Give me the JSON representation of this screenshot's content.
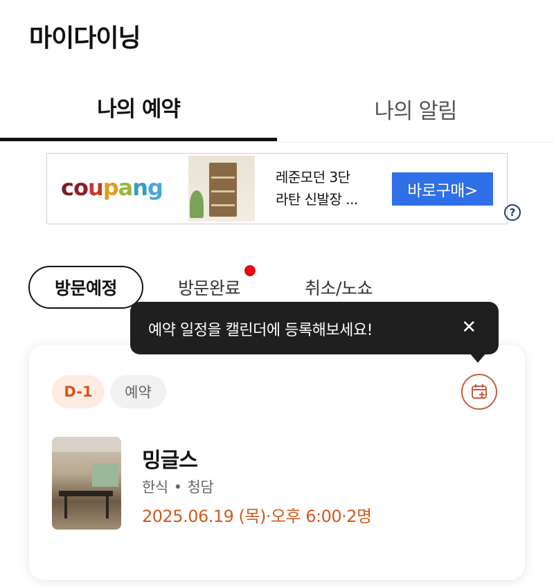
{
  "header": {
    "title": "마이다이닝"
  },
  "tabs": [
    {
      "label": "나의 예약",
      "active": true
    },
    {
      "label": "나의 알림",
      "active": false
    }
  ],
  "ad": {
    "logo": "coupang",
    "product_line1": "레준모던 3단",
    "product_line2": "라탄 신발장 ...",
    "cta": "바로구매>",
    "help_icon": "question-circle-icon",
    "cta_color": "#2f6fe8"
  },
  "filters": {
    "items": [
      "방문예정",
      "방문완료",
      "취소/노쇼"
    ],
    "selected": "방문예정",
    "notification_dot_on": "방문완료"
  },
  "tooltip": {
    "text": "예약 일정을 캘린더에 등록해보세요!",
    "close_icon": "close-icon"
  },
  "reservation": {
    "dday": "D-1",
    "status": "예약",
    "calendar_icon": "calendar-add-icon",
    "restaurant": "밍글스",
    "category": "한식",
    "separator": "•",
    "area": "청담",
    "datetime": "2025.06.19 (목)·오후 6:00·2명",
    "accent_color": "#cf5a20"
  }
}
